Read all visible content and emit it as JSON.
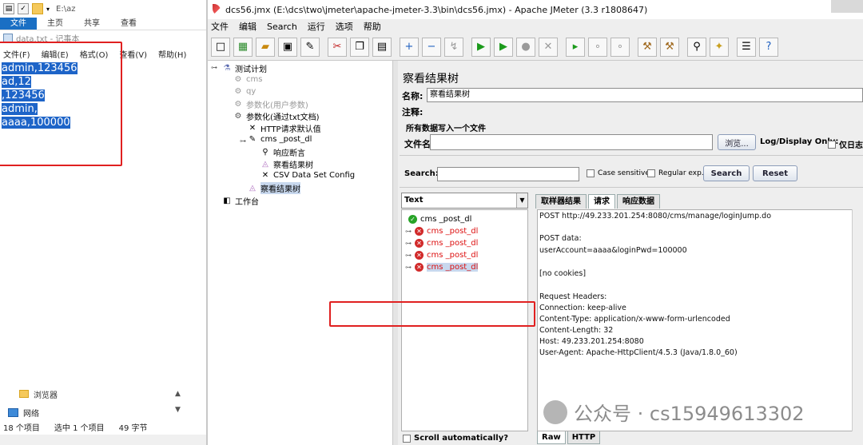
{
  "explorer": {
    "path": "E:\\az",
    "ribbon_tabs": [
      "文件",
      "主页",
      "共享",
      "查看"
    ],
    "browser_folder": "浏览器",
    "network": "网络",
    "status_count": "18 个项目",
    "status_selected": "选中 1 个项目",
    "status_bytes": "49 字节"
  },
  "notepad": {
    "title": "data.txt - 记事本",
    "menu": [
      "文件(F)",
      "编辑(E)",
      "格式(O)",
      "查看(V)",
      "帮助(H)"
    ],
    "lines": [
      "admin,123456",
      "ad,12",
      ",123456",
      "admin,",
      "aaaa,100000"
    ]
  },
  "jmeter": {
    "title": "dcs56.jmx (E:\\dcs\\two\\jmeter\\apache-jmeter-3.3\\bin\\dcs56.jmx) - Apache JMeter (3.3 r1808647)",
    "menu": [
      "文件",
      "编辑",
      "Search",
      "运行",
      "选项",
      "帮助"
    ],
    "tree": {
      "test_plan": "测试计划",
      "items": [
        {
          "label": "cms",
          "disabled": true
        },
        {
          "label": "qy",
          "disabled": true
        },
        {
          "label": "参数化(用户参数)",
          "disabled": true
        },
        {
          "label": "参数化(通过txt文档)",
          "disabled": false
        }
      ],
      "children": [
        "HTTP请求默认值",
        "cms _post_dl"
      ],
      "grandchildren": [
        "响应断言",
        "察看结果树",
        "CSV Data Set Config"
      ],
      "selected": "察看结果树",
      "workbench": "工作台"
    },
    "panel": {
      "heading": "察看结果树",
      "name_label": "名称:",
      "name_value": "察看结果树",
      "comment_label": "注释:",
      "write_all": "所有数据写入一个文件",
      "filename_label": "文件名",
      "browse_button": "浏览...",
      "log_display": "Log/Display Only:",
      "errors_only": "仅日志",
      "search_label": "Search:",
      "case_sensitive": "Case sensitive",
      "regular_exp": "Regular exp.",
      "search_button": "Search",
      "reset_button": "Reset"
    },
    "results": {
      "renderer": "Text",
      "samples": [
        {
          "label": "cms _post_dl",
          "success": true
        },
        {
          "label": "cms _post_dl",
          "success": false
        },
        {
          "label": "cms _post_dl",
          "success": false
        },
        {
          "label": "cms _post_dl",
          "success": false
        },
        {
          "label": "cms _post_dl",
          "success": false
        }
      ],
      "scroll_auto": "Scroll automatically?"
    },
    "detail": {
      "tabs": [
        "取样器结果",
        "请求",
        "响应数据"
      ],
      "active_tab": "请求",
      "lines": [
        "POST http://49.233.201.254:8080/cms/manage/loginJump.do",
        "",
        "POST data:",
        "userAccount=aaaa&loginPwd=100000",
        "",
        "[no cookies]",
        "",
        "Request Headers:",
        "Connection: keep-alive",
        "Content-Type: application/x-www-form-urlencoded",
        "Content-Length: 32",
        "Host: 49.233.201.254:8080",
        "User-Agent: Apache-HttpClient/4.5.3 (Java/1.8.0_60)"
      ],
      "bottom_tabs": [
        "Raw",
        "HTTP"
      ]
    }
  },
  "watermark": "公众号 · cs15949613302"
}
